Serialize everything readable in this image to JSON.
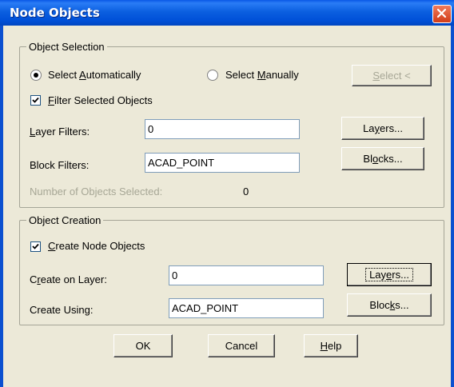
{
  "window": {
    "title": "Node Objects"
  },
  "selection_group": {
    "legend": "Object Selection",
    "radio_auto": {
      "pre": "Select ",
      "acc": "A",
      "post": "utomatically",
      "checked": true
    },
    "radio_manual": {
      "pre": "Select ",
      "acc": "M",
      "post": "anually",
      "checked": false
    },
    "select_button": {
      "acc": "S",
      "post": "elect <"
    },
    "filter_check": {
      "acc": "F",
      "post": "ilter Selected Objects",
      "checked": true
    },
    "layer_filters": {
      "acc": "L",
      "post": "ayer Filters:",
      "value": "0"
    },
    "layers_button": {
      "pre": "La",
      "acc": "y",
      "post": "ers..."
    },
    "block_filters": {
      "label": "Block Filters:",
      "value": "ACAD_POINT"
    },
    "blocks_button": {
      "pre": "Bl",
      "acc": "o",
      "post": "cks..."
    },
    "count": {
      "label": "Number of Objects Selected:",
      "value": "0"
    }
  },
  "creation_group": {
    "legend": "Object Creation",
    "create_check": {
      "acc": "C",
      "post": "reate Node Objects",
      "checked": true
    },
    "create_layer": {
      "pre": "C",
      "acc": "r",
      "post": "eate on Layer:",
      "value": "0"
    },
    "layers_button": {
      "pre": "Lay",
      "acc": "e",
      "post": "rs..."
    },
    "create_using": {
      "label": "Create Using:",
      "value": "ACAD_POINT"
    },
    "blocks_button": {
      "pre": "Bloc",
      "acc": "k",
      "post": "s..."
    }
  },
  "footer": {
    "ok": "OK",
    "cancel": "Cancel",
    "help": {
      "acc": "H",
      "post": "elp"
    }
  }
}
